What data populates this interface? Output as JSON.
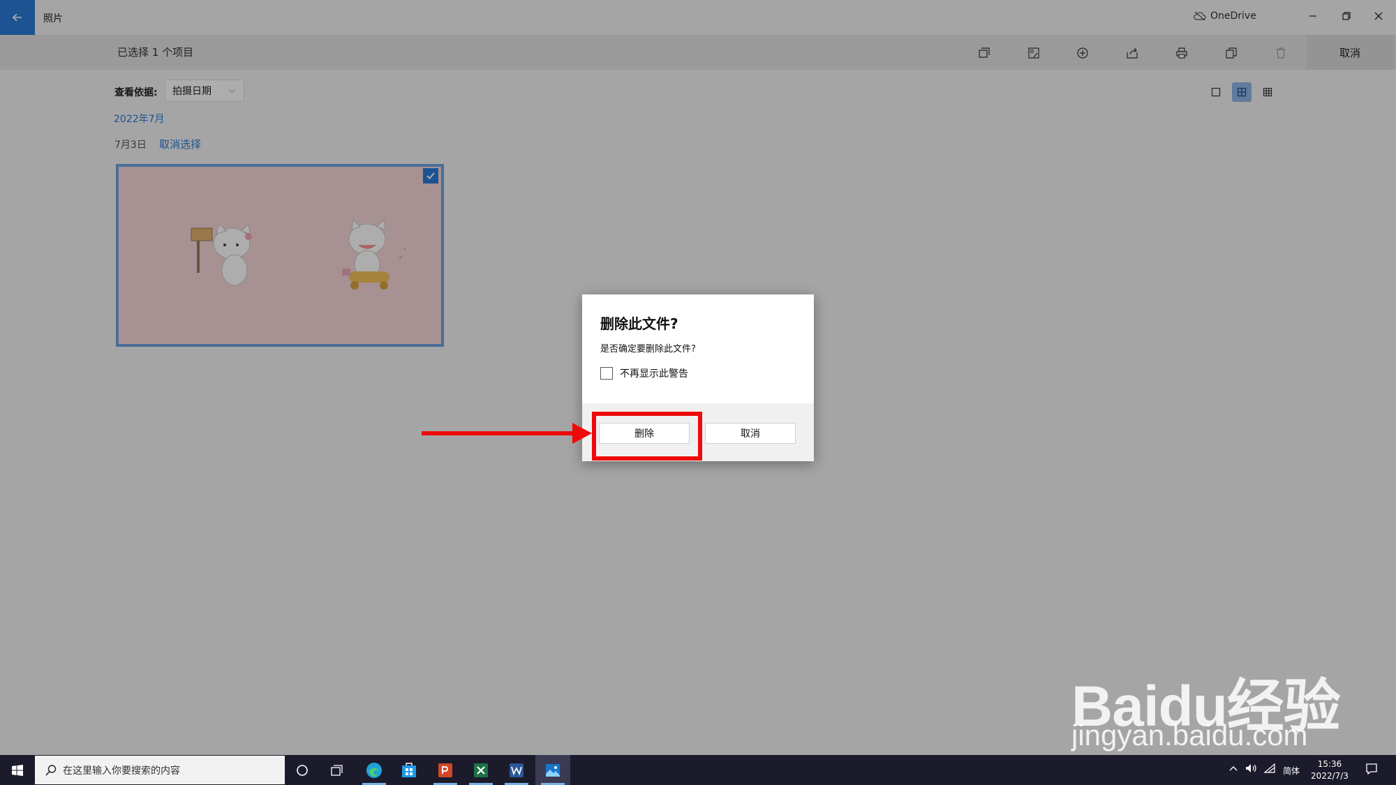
{
  "app": {
    "title": "照片",
    "onedrive": "OneDrive"
  },
  "selection_bar": {
    "count_label": "已选择 1 个项目",
    "cancel_label": "取消"
  },
  "view": {
    "label": "查看依据:",
    "selected": "拍摄日期"
  },
  "gallery": {
    "month": "2022年7月",
    "day": "7月3日",
    "deselect": "取消选择"
  },
  "dialog": {
    "title": "删除此文件?",
    "message": "是否确定要删除此文件?",
    "checkbox_label": "不再显示此警告",
    "delete_label": "删除",
    "cancel_label": "取消"
  },
  "taskbar": {
    "search_placeholder": "在这里输入你要搜索的内容",
    "ime": "简体",
    "time": "15:36",
    "date": "2022/7/3"
  },
  "watermark": {
    "logo": "Baidu经验",
    "url": "jingyan.baidu.com"
  },
  "colors": {
    "accent": "#2b7bd8",
    "annotation": "#ee0a0a",
    "taskbar": "#1b1b2b"
  }
}
